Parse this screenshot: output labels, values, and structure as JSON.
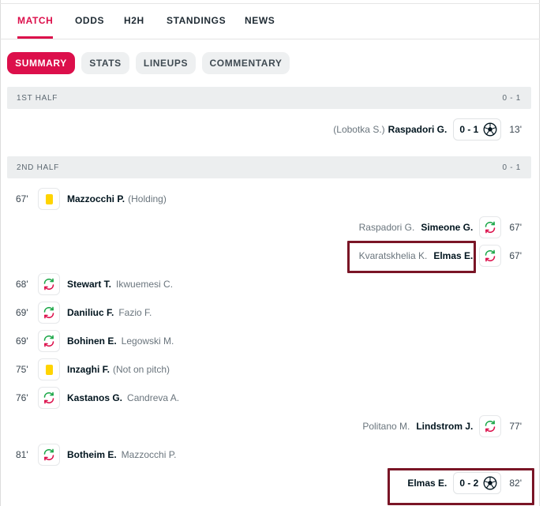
{
  "tabs": [
    {
      "label": "MATCH",
      "active": true
    },
    {
      "label": "ODDS"
    },
    {
      "label": "H2H"
    },
    {
      "label": "STANDINGS"
    },
    {
      "label": "NEWS"
    }
  ],
  "subtabs": [
    {
      "label": "SUMMARY",
      "active": true
    },
    {
      "label": "STATS"
    },
    {
      "label": "LINEUPS"
    },
    {
      "label": "COMMENTARY"
    }
  ],
  "first_half": {
    "title": "1ST HALF",
    "score": "0 - 1",
    "incidents": [
      {
        "side": "away",
        "type": "goal",
        "minute": "13'",
        "player": "Raspadori G.",
        "assist": "(Lobotka S.)",
        "score": "0 - 1"
      }
    ]
  },
  "second_half": {
    "title": "2ND HALF",
    "score": "0 - 1",
    "incidents": [
      {
        "side": "home",
        "type": "yellow-card",
        "minute": "67'",
        "player": "Mazzocchi P.",
        "reason": "(Holding)"
      },
      {
        "side": "away",
        "type": "substitution",
        "minute": "67'",
        "player_in": "Simeone G.",
        "player_out": "Raspadori G."
      },
      {
        "side": "away",
        "type": "substitution",
        "minute": "67'",
        "player_in": "Elmas E.",
        "player_out": "Kvaratskhelia K."
      },
      {
        "side": "home",
        "type": "substitution",
        "minute": "68'",
        "player_in": "Stewart T.",
        "player_out": "Ikwuemesi C."
      },
      {
        "side": "home",
        "type": "substitution",
        "minute": "69'",
        "player_in": "Daniliuc F.",
        "player_out": "Fazio F."
      },
      {
        "side": "home",
        "type": "substitution",
        "minute": "69'",
        "player_in": "Bohinen E.",
        "player_out": "Legowski M."
      },
      {
        "side": "home",
        "type": "yellow-card",
        "minute": "75'",
        "player": "Inzaghi F.",
        "reason": "(Not on pitch)"
      },
      {
        "side": "home",
        "type": "substitution",
        "minute": "76'",
        "player_in": "Kastanos G.",
        "player_out": "Candreva A."
      },
      {
        "side": "away",
        "type": "substitution",
        "minute": "77'",
        "player_in": "Lindstrom J.",
        "player_out": "Politano M."
      },
      {
        "side": "home",
        "type": "substitution",
        "minute": "81'",
        "player_in": "Botheim E.",
        "player_out": "Mazzocchi P."
      },
      {
        "side": "away",
        "type": "goal",
        "minute": "82'",
        "player": "Elmas E.",
        "score": "0 - 2"
      }
    ]
  },
  "colors": {
    "accent": "#dc0f4b",
    "yellow_card": "#ffd400",
    "sub_in": "#1ea84a",
    "sub_out": "#dc0f4b",
    "highlight_border": "#7a1526"
  },
  "icons": {
    "goal": "soccer-ball-icon",
    "substitution": "substitution-arrows-icon",
    "yellow_card": "yellow-card-icon"
  }
}
